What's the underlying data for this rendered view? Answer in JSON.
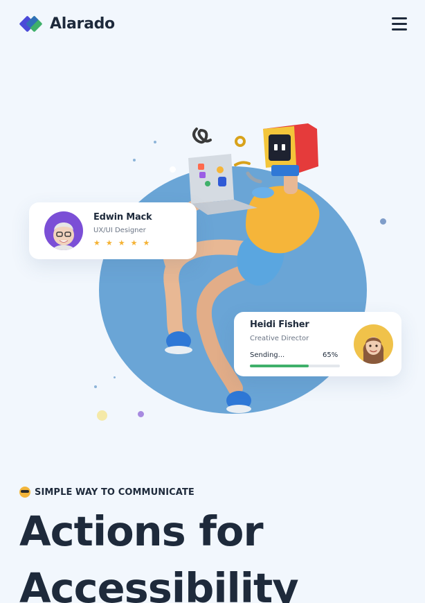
{
  "header": {
    "brand": "Alarado",
    "menu_icon": "hamburger-menu-icon"
  },
  "colors": {
    "background": "#f2f7fd",
    "brand_blue": "#4a4ad8",
    "brand_green": "#3fb06a",
    "circle": "#6aa5d6",
    "text_dark": "#1e2a3b",
    "star": "#f5b233"
  },
  "hero": {
    "card_profile": {
      "name": "Edwin Mack",
      "role": "UX/UI Designer",
      "rating": 5,
      "avatar_icon": "memoji-avatar-icon"
    },
    "card_status": {
      "name": "Heidi Fisher",
      "role": "Creative Director",
      "sending_label": "Sending...",
      "progress_text": "65%",
      "progress": 0.65,
      "avatar_icon": "memoji-avatar-icon"
    }
  },
  "intro": {
    "tagline_icon": "sunglasses-emoji-icon",
    "tagline": "SIMPLE WAY TO COMMUNICATE",
    "headline": "Actions for Accessibility"
  }
}
